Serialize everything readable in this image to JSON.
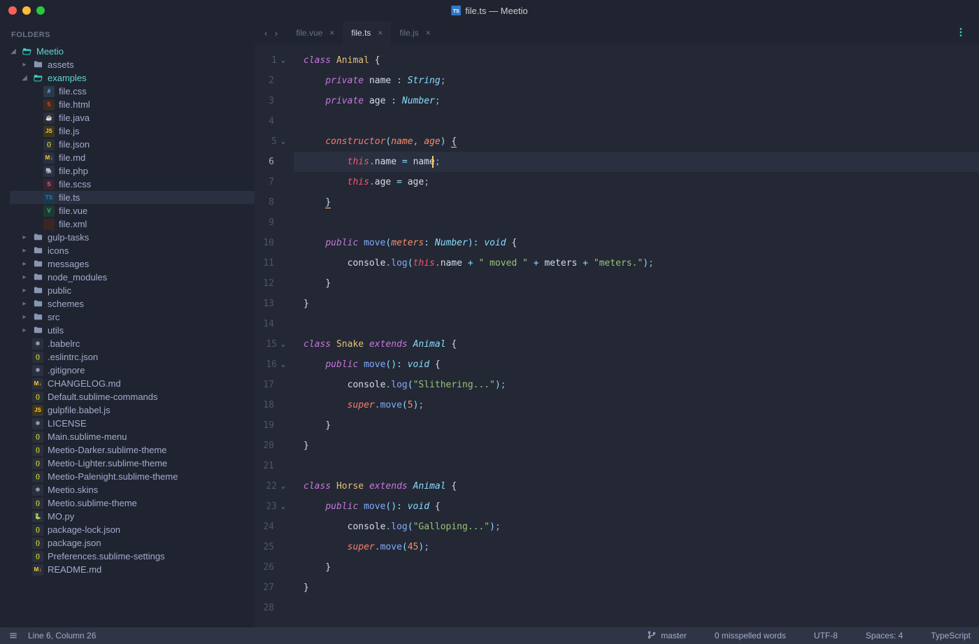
{
  "window": {
    "title": "file.ts — Meetio"
  },
  "sidebar": {
    "header": "FOLDERS",
    "root": {
      "name": "Meetio",
      "expanded": true
    },
    "examples_folder": "examples",
    "folders": [
      {
        "name": "assets"
      },
      {
        "name": "gulp-tasks"
      },
      {
        "name": "icons"
      },
      {
        "name": "messages"
      },
      {
        "name": "node_modules"
      },
      {
        "name": "public"
      },
      {
        "name": "schemes"
      },
      {
        "name": "src"
      },
      {
        "name": "utils"
      }
    ],
    "example_files": [
      {
        "name": "file.css",
        "type": "css"
      },
      {
        "name": "file.html",
        "type": "html"
      },
      {
        "name": "file.java",
        "type": "java"
      },
      {
        "name": "file.js",
        "type": "js"
      },
      {
        "name": "file.json",
        "type": "json"
      },
      {
        "name": "file.md",
        "type": "md"
      },
      {
        "name": "file.php",
        "type": "php"
      },
      {
        "name": "file.scss",
        "type": "scss"
      },
      {
        "name": "file.ts",
        "type": "ts",
        "active": true
      },
      {
        "name": "file.vue",
        "type": "vue"
      },
      {
        "name": "file.xml",
        "type": "xml"
      }
    ],
    "root_files": [
      {
        "name": ".babelrc",
        "type": "plain"
      },
      {
        "name": ".eslintrc.json",
        "type": "json"
      },
      {
        "name": ".gitignore",
        "type": "plain"
      },
      {
        "name": "CHANGELOG.md",
        "type": "md"
      },
      {
        "name": "Default.sublime-commands",
        "type": "json"
      },
      {
        "name": "gulpfile.babel.js",
        "type": "js"
      },
      {
        "name": "LICENSE",
        "type": "plain"
      },
      {
        "name": "Main.sublime-menu",
        "type": "json"
      },
      {
        "name": "Meetio-Darker.sublime-theme",
        "type": "json"
      },
      {
        "name": "Meetio-Lighter.sublime-theme",
        "type": "json"
      },
      {
        "name": "Meetio-Palenight.sublime-theme",
        "type": "json"
      },
      {
        "name": "Meetio.skins",
        "type": "plain"
      },
      {
        "name": "Meetio.sublime-theme",
        "type": "json"
      },
      {
        "name": "MO.py",
        "type": "py"
      },
      {
        "name": "package-lock.json",
        "type": "json"
      },
      {
        "name": "package.json",
        "type": "json"
      },
      {
        "name": "Preferences.sublime-settings",
        "type": "json"
      },
      {
        "name": "README.md",
        "type": "md"
      }
    ]
  },
  "tabs": [
    {
      "label": "file.vue",
      "active": false
    },
    {
      "label": "file.ts",
      "active": true
    },
    {
      "label": "file.js",
      "active": false
    }
  ],
  "editor": {
    "current_line": 6,
    "lines": [
      {
        "n": 1,
        "fold": true
      },
      {
        "n": 2
      },
      {
        "n": 3
      },
      {
        "n": 4
      },
      {
        "n": 5,
        "fold": true
      },
      {
        "n": 6,
        "current": true
      },
      {
        "n": 7
      },
      {
        "n": 8
      },
      {
        "n": 9
      },
      {
        "n": 10
      },
      {
        "n": 11
      },
      {
        "n": 12
      },
      {
        "n": 13
      },
      {
        "n": 14
      },
      {
        "n": 15,
        "fold": true
      },
      {
        "n": 16,
        "fold": true
      },
      {
        "n": 17
      },
      {
        "n": 18
      },
      {
        "n": 19
      },
      {
        "n": 20
      },
      {
        "n": 21
      },
      {
        "n": 22,
        "fold": true
      },
      {
        "n": 23,
        "fold": true
      },
      {
        "n": 24
      },
      {
        "n": 25
      },
      {
        "n": 26
      },
      {
        "n": 27
      },
      {
        "n": 28
      }
    ]
  },
  "code_tokens": {
    "class": "class",
    "private": "private",
    "public": "public",
    "extends": "extends",
    "constructor": "constructor",
    "this": "this",
    "super": "super",
    "void": "void",
    "Animal": "Animal",
    "Snake": "Snake",
    "Horse": "Horse",
    "String": "String",
    "Number": "Number",
    "name": "name",
    "age": "age",
    "move": "move",
    "meters": "meters",
    "console": "console",
    "log": "log",
    "str_moved": "\" moved \"",
    "str_meters": "\"meters.\"",
    "str_slither": "\"Slithering...\"",
    "str_gallop": "\"Galloping...\"",
    "n5": "5",
    "n45": "45"
  },
  "status": {
    "cursor": "Line 6, Column 26",
    "branch": "master",
    "spell": "0 misspelled words",
    "encoding": "UTF-8",
    "spaces": "Spaces: 4",
    "syntax": "TypeScript"
  }
}
